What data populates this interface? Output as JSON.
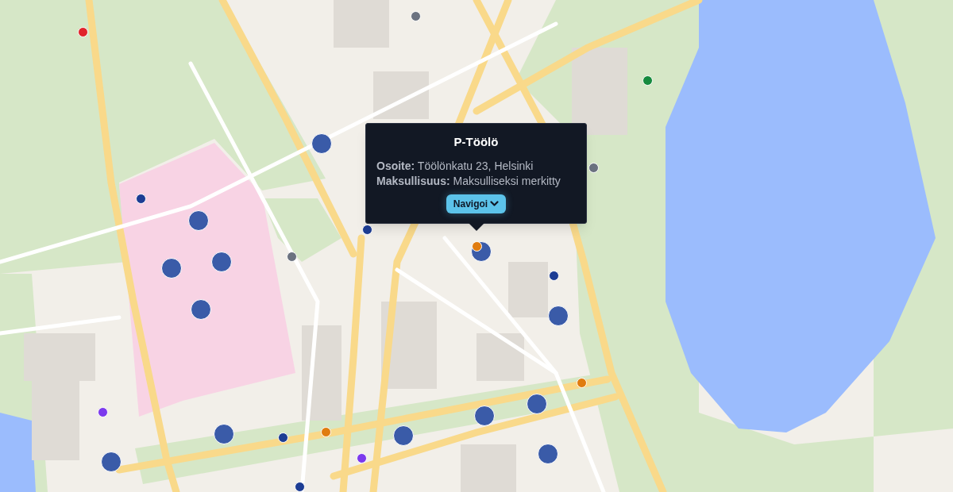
{
  "markers": [
    {
      "kind": "small",
      "color": "#6b7280"
    },
    {
      "kind": "small",
      "color": "#e0242b"
    },
    {
      "kind": "small",
      "color": "#168a3e"
    },
    {
      "kind": "large",
      "color": "#3a5ba8"
    },
    {
      "kind": "small",
      "color": "#6b7280"
    },
    {
      "kind": "small",
      "color": "#1d3d94"
    },
    {
      "kind": "large",
      "color": "#3a5ba8"
    },
    {
      "kind": "small",
      "color": "#1d3d94"
    },
    {
      "kind": "large",
      "color": "#3a5ba8"
    },
    {
      "kind": "small",
      "color": "#e07c0f"
    },
    {
      "kind": "small",
      "color": "#6b7280"
    },
    {
      "kind": "large",
      "color": "#3a5ba8"
    },
    {
      "kind": "large",
      "color": "#3a5ba8"
    },
    {
      "kind": "small",
      "color": "#1d3d94"
    },
    {
      "kind": "large",
      "color": "#3a5ba8"
    },
    {
      "kind": "large",
      "color": "#3a5ba8"
    },
    {
      "kind": "small",
      "color": "#e07c0f"
    },
    {
      "kind": "large",
      "color": "#3a5ba8"
    },
    {
      "kind": "small",
      "color": "#7c3aed"
    },
    {
      "kind": "large",
      "color": "#3a5ba8"
    },
    {
      "kind": "small",
      "color": "#e07c0f"
    },
    {
      "kind": "large",
      "color": "#3a5ba8"
    },
    {
      "kind": "large",
      "color": "#3a5ba8"
    },
    {
      "kind": "small",
      "color": "#1d3d94"
    },
    {
      "kind": "large",
      "color": "#3a5ba8"
    },
    {
      "kind": "small",
      "color": "#7c3aed"
    },
    {
      "kind": "large",
      "color": "#3a5ba8"
    },
    {
      "kind": "small",
      "color": "#1d3d94"
    }
  ],
  "popup": {
    "title": "P-Töölö",
    "lines": [
      "**Osoite:** Töölönkatu 23, Helsinki",
      "**Maksullisuus:** Maksulliseksi merkitty"
    ],
    "button": {
      "label": "Navigoi"
    }
  }
}
